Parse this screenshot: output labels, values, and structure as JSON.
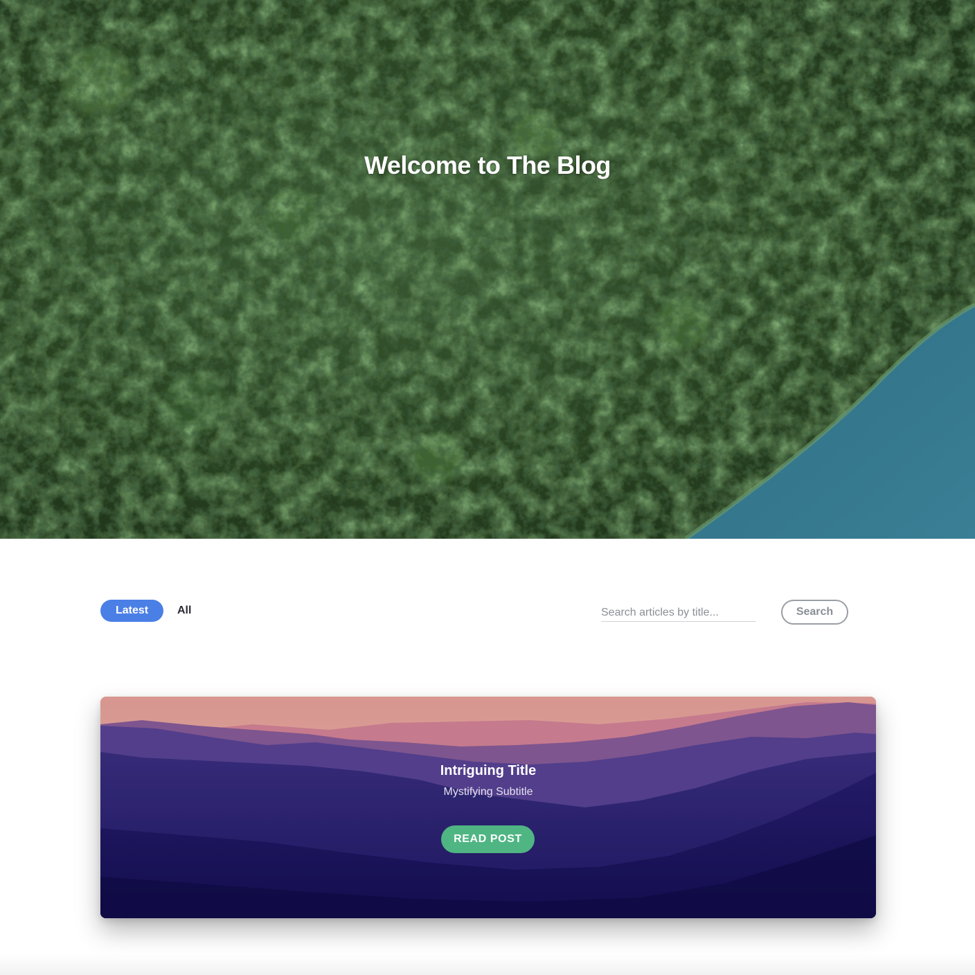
{
  "hero": {
    "title": "Welcome to The Blog",
    "image": "aerial-forest-with-lake"
  },
  "filters": {
    "tabs": [
      {
        "label": "Latest",
        "active": true
      },
      {
        "label": "All",
        "active": false
      }
    ],
    "search": {
      "placeholder": "Search articles by title...",
      "value": "",
      "button_label": "Search"
    }
  },
  "posts": [
    {
      "title": "Intriguing Title",
      "subtitle": "Mystifying Subtitle",
      "button_label": "READ POST",
      "image": "purple-mountain-sunset"
    }
  ],
  "colors": {
    "accent": "#4a7fe6",
    "button_green": "#4fb583",
    "text_dark": "#2b2b33",
    "muted": "#8a8f96"
  }
}
